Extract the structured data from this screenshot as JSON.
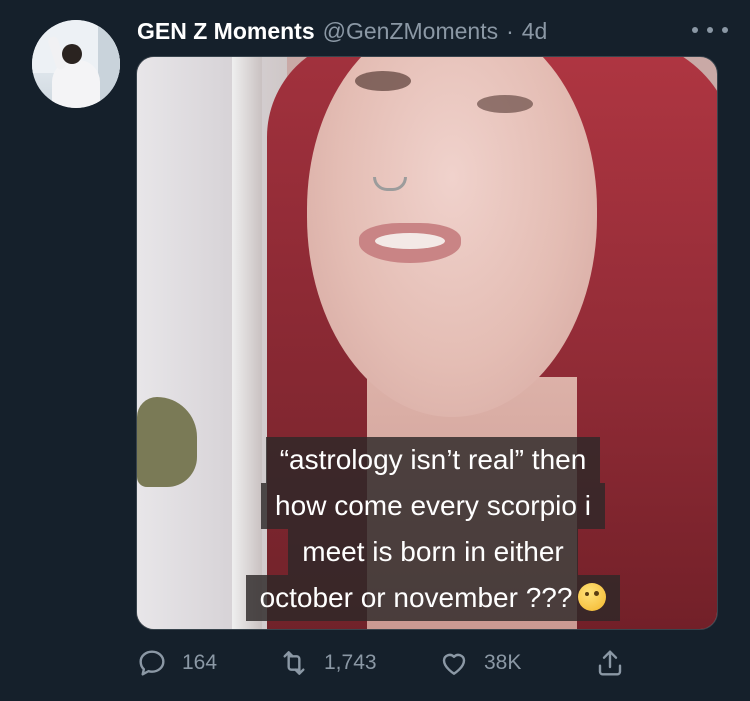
{
  "tweet": {
    "display_name": "GEN Z Moments",
    "handle": "@GenZMoments",
    "separator": "·",
    "time": "4d",
    "caption": [
      "“astrology isn’t real” then",
      "how come every scorpio i",
      "meet is born in either",
      "october or november ???"
    ],
    "caption_emoji": "raised-eyebrow-face"
  },
  "actions": {
    "reply_count": "164",
    "retweet_count": "1,743",
    "like_count": "38K"
  },
  "colors": {
    "background": "#15202b",
    "secondary_text": "#8b98a5",
    "border": "#38444d"
  }
}
